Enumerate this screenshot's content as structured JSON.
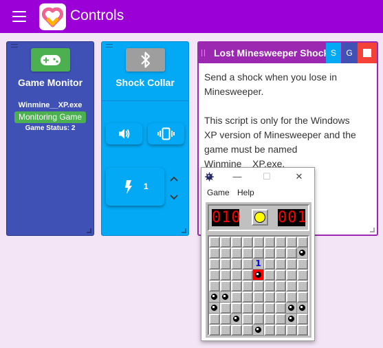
{
  "app": {
    "title": "Controls"
  },
  "game_monitor": {
    "title": "Game Monitor",
    "exe": "Winmine__XP.exe",
    "status_badge": "Monitoring Game",
    "game_status": "Game Status: 2"
  },
  "shock_collar": {
    "title": "Shock Collar",
    "shock_value": "1"
  },
  "script": {
    "title": "Lost Minesweeper Shock",
    "btn_s": "S",
    "btn_g": "G",
    "description_1": "Send a shock when you lose in Minesweeper.",
    "description_2": "This script is only for the Windows XP version of Minesweeper and the game must be named Winmine__XP.exe."
  },
  "minesweeper": {
    "menu": [
      "Game",
      "Help"
    ],
    "counter_left": "010",
    "counter_right": "001",
    "colors": {
      "number": "#0000ff",
      "counter": "#ff0000",
      "hit": "#ff0000"
    }
  }
}
